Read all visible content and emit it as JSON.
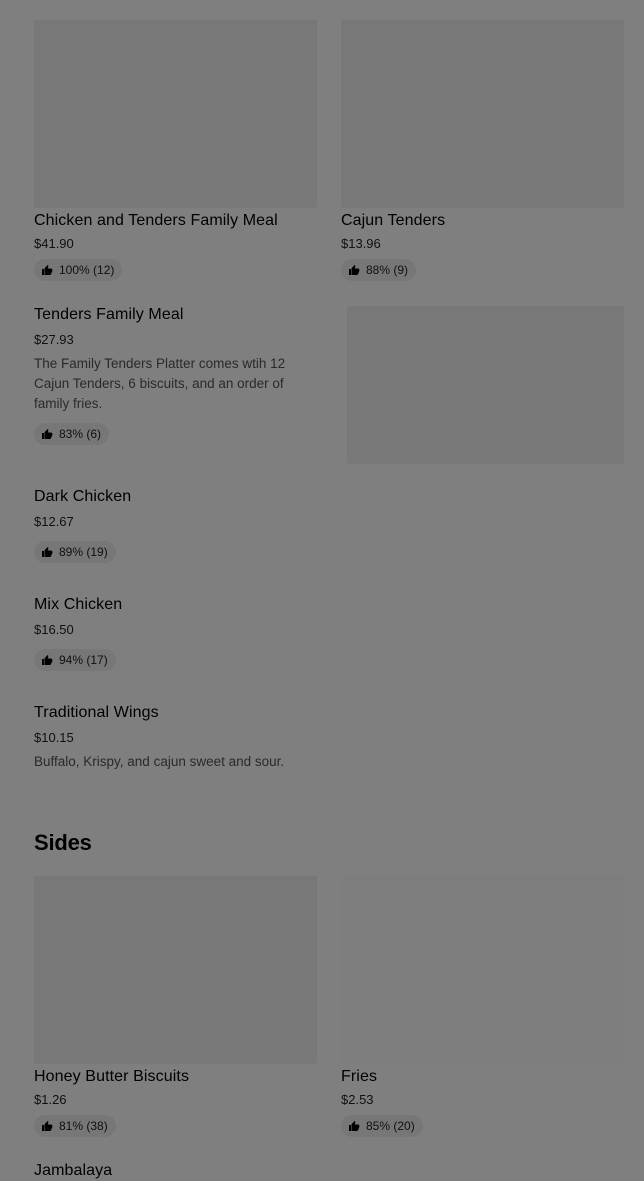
{
  "items": [
    {
      "title": "Chicken and Tenders Family Meal",
      "price": "$41.90",
      "rating": "100% (12)"
    },
    {
      "title": "Cajun Tenders",
      "price": "$13.96",
      "rating": "88% (9)"
    },
    {
      "title": "Tenders Family Meal",
      "price": "$27.93",
      "description": "The Family Tenders Platter comes wtih 12 Cajun Tenders, 6 biscuits, and an order of family fries.",
      "rating": "83% (6)"
    },
    {
      "title": "Dark Chicken",
      "price": "$12.67",
      "rating": "89% (19)"
    },
    {
      "title": "Mix Chicken",
      "price": "$16.50",
      "rating": "94% (17)"
    },
    {
      "title": "Traditional Wings",
      "price": "$10.15",
      "description": "Buffalo, Krispy, and cajun sweet and sour."
    }
  ],
  "sides": {
    "heading": "Sides",
    "items": [
      {
        "title": "Honey Butter Biscuits",
        "price": "$1.26",
        "rating": "81% (38)"
      },
      {
        "title": "Fries",
        "price": "$2.53",
        "rating": "85% (20)"
      },
      {
        "title": "Jambalaya"
      }
    ]
  },
  "icons": {
    "rating": "thumbs-up-icon"
  },
  "overlay_color": "#000000"
}
